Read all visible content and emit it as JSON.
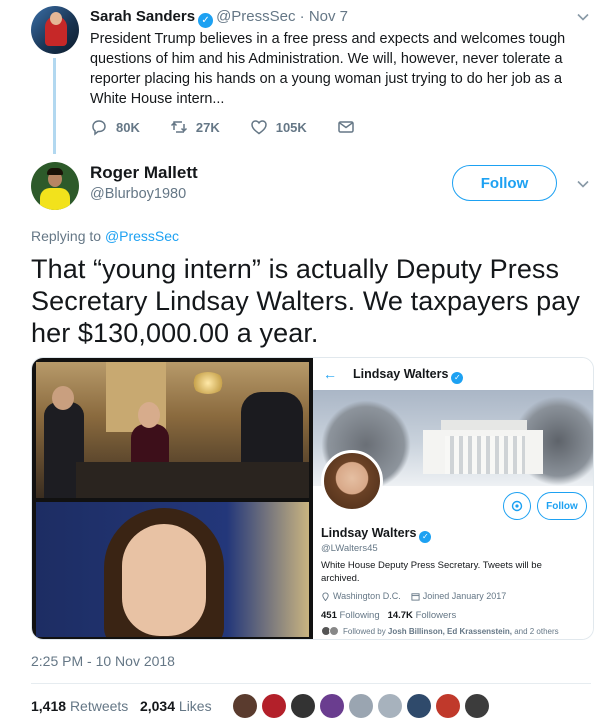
{
  "parent_tweet": {
    "name": "Sarah Sanders",
    "handle": "@PressSec",
    "separator": "·",
    "date": "Nov 7",
    "text": "President Trump believes in a free press and expects and welcomes tough questions of him and his Administration. We will, however, never tolerate a reporter placing his hands on a young woman just trying to do her job as a White House intern...",
    "actions": {
      "replies": "80K",
      "retweets": "27K",
      "likes": "105K"
    }
  },
  "main_tweet": {
    "name": "Roger Mallett",
    "handle": "@Blurboy1980",
    "follow_label": "Follow",
    "replying_prefix": "Replying to",
    "replying_to": "@PressSec",
    "text": "That “young intern” is actually Deputy Press Secretary Lindsay Walters. We taxpayers pay her $130,000.00 a year.",
    "timestamp": "2:25 PM - 10 Nov 2018",
    "retweet_count": "1,418",
    "retweet_label": "Retweets",
    "like_count": "2,034",
    "like_label": "Likes",
    "liker_colors": [
      "#5a3b2e",
      "#b3202a",
      "#333333",
      "#6a3d8f",
      "#9aa5b1",
      "#a7b2bd",
      "#2f4a6b",
      "#c0392b",
      "#3c3c3c"
    ]
  },
  "embedded_profile": {
    "back_arrow": "←",
    "header_name": "Lindsay Walters",
    "follow_label": "Follow",
    "name": "Lindsay Walters",
    "handle": "@LWalters45",
    "bio": "White House Deputy Press Secretary. Tweets will be archived.",
    "location": "Washington D.C.",
    "joined": "Joined January 2017",
    "following_count": "451",
    "following_label": "Following",
    "followers_count": "14.7K",
    "followers_label": "Followers",
    "followed_by_prefix": "Followed by",
    "followed_by_names": "Josh Billinson, Ed Krassenstein,",
    "followed_by_suffix": "and 2 others"
  },
  "colors": {
    "brand_blue": "#1da1f2",
    "muted_text": "#657786",
    "thread_line": "#b2d8f0"
  }
}
